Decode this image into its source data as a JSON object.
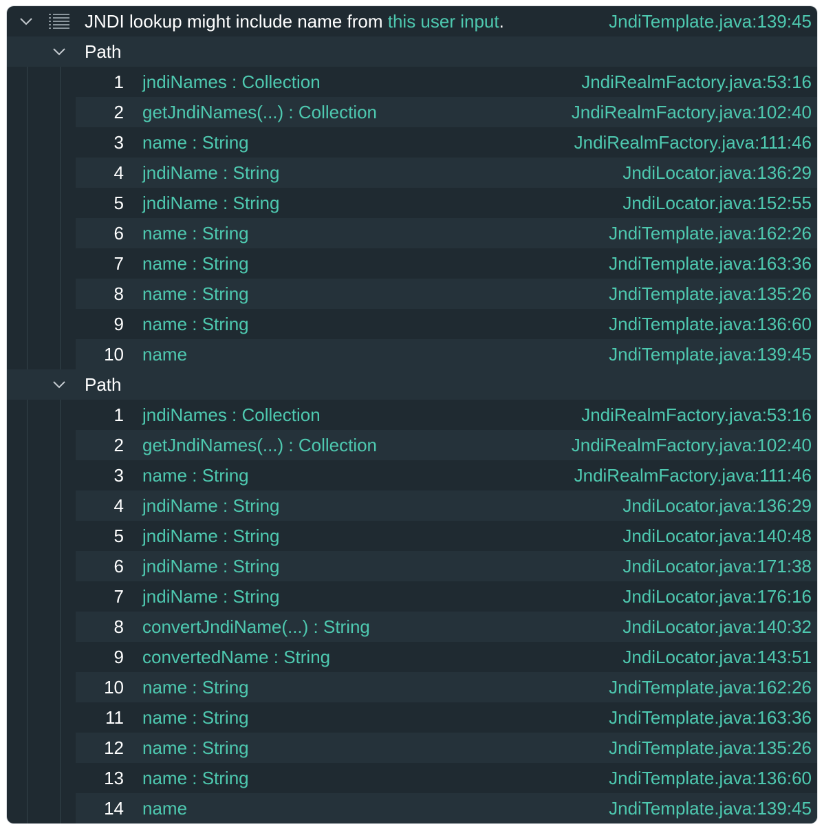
{
  "alert": {
    "message_prefix": "JNDI lookup might include name from ",
    "message_link": "this user input",
    "message_suffix": ".",
    "location": "JndiTemplate.java:139:45",
    "icon": "list-icon"
  },
  "paths": [
    {
      "label": "Path",
      "steps": [
        {
          "num": "1",
          "text": "jndiNames : Collection",
          "loc": "JndiRealmFactory.java:53:16"
        },
        {
          "num": "2",
          "text": "getJndiNames(...) : Collection",
          "loc": "JndiRealmFactory.java:102:40"
        },
        {
          "num": "3",
          "text": "name : String",
          "loc": "JndiRealmFactory.java:111:46"
        },
        {
          "num": "4",
          "text": "jndiName : String",
          "loc": "JndiLocator.java:136:29"
        },
        {
          "num": "5",
          "text": "jndiName : String",
          "loc": "JndiLocator.java:152:55"
        },
        {
          "num": "6",
          "text": "name : String",
          "loc": "JndiTemplate.java:162:26"
        },
        {
          "num": "7",
          "text": "name : String",
          "loc": "JndiTemplate.java:163:36"
        },
        {
          "num": "8",
          "text": "name : String",
          "loc": "JndiTemplate.java:135:26"
        },
        {
          "num": "9",
          "text": "name : String",
          "loc": "JndiTemplate.java:136:60"
        },
        {
          "num": "10",
          "text": "name",
          "loc": "JndiTemplate.java:139:45"
        }
      ]
    },
    {
      "label": "Path",
      "steps": [
        {
          "num": "1",
          "text": "jndiNames : Collection",
          "loc": "JndiRealmFactory.java:53:16"
        },
        {
          "num": "2",
          "text": "getJndiNames(...) : Collection",
          "loc": "JndiRealmFactory.java:102:40"
        },
        {
          "num": "3",
          "text": "name : String",
          "loc": "JndiRealmFactory.java:111:46"
        },
        {
          "num": "4",
          "text": "jndiName : String",
          "loc": "JndiLocator.java:136:29"
        },
        {
          "num": "5",
          "text": "jndiName : String",
          "loc": "JndiLocator.java:140:48"
        },
        {
          "num": "6",
          "text": "jndiName : String",
          "loc": "JndiLocator.java:171:38"
        },
        {
          "num": "7",
          "text": "jndiName : String",
          "loc": "JndiLocator.java:176:16"
        },
        {
          "num": "8",
          "text": "convertJndiName(...) : String",
          "loc": "JndiLocator.java:140:32"
        },
        {
          "num": "9",
          "text": "convertedName : String",
          "loc": "JndiLocator.java:143:51"
        },
        {
          "num": "10",
          "text": "name : String",
          "loc": "JndiTemplate.java:162:26"
        },
        {
          "num": "11",
          "text": "name : String",
          "loc": "JndiTemplate.java:163:36"
        },
        {
          "num": "12",
          "text": "name : String",
          "loc": "JndiTemplate.java:135:26"
        },
        {
          "num": "13",
          "text": "name : String",
          "loc": "JndiTemplate.java:136:60"
        },
        {
          "num": "14",
          "text": "name",
          "loc": "JndiTemplate.java:139:45"
        }
      ]
    }
  ],
  "colors": {
    "background": "#1f2a31",
    "row_alt": "#25323a",
    "link": "#4ec9b0",
    "text": "#ffffff",
    "chevron": "#c5cbd0"
  }
}
